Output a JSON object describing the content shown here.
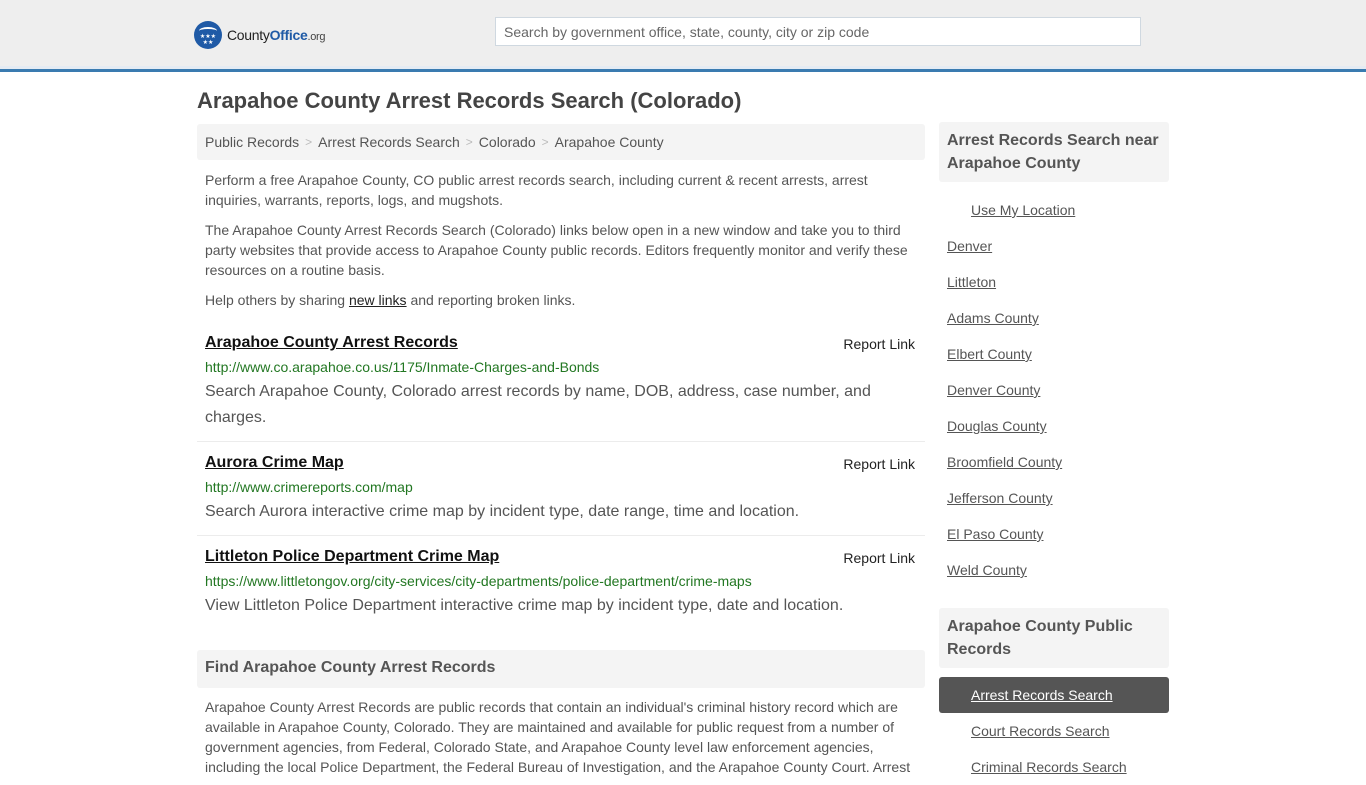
{
  "header": {
    "logo": {
      "county": "County",
      "office": "Office",
      "org": ".org"
    },
    "search": {
      "placeholder": "Search by government office, state, county, city or zip code",
      "value": ""
    }
  },
  "page": {
    "title": "Arapahoe County Arrest Records Search (Colorado)"
  },
  "breadcrumb": {
    "items": [
      "Public Records",
      "Arrest Records Search",
      "Colorado",
      "Arapahoe County"
    ],
    "separator": ">"
  },
  "intro": {
    "p1": "Perform a free Arapahoe County, CO public arrest records search, including current & recent arrests, arrest inquiries, warrants, reports, logs, and mugshots.",
    "p2": "The Arapahoe County Arrest Records Search (Colorado) links below open in a new window and take you to third party websites that provide access to Arapahoe County public records. Editors frequently monitor and verify these resources on a routine basis.",
    "p3_before": "Help others by sharing ",
    "p3_link": "new links",
    "p3_after": " and reporting broken links."
  },
  "results": [
    {
      "title": "Arapahoe County Arrest Records",
      "url": "http://www.co.arapahoe.co.us/1175/Inmate-Charges-and-Bonds",
      "description": "Search Arapahoe County, Colorado arrest records by name, DOB, address, case number, and charges.",
      "report_label": "Report Link"
    },
    {
      "title": "Aurora Crime Map",
      "url": "http://www.crimereports.com/map",
      "description": "Search Aurora interactive crime map by incident type, date range, time and location.",
      "report_label": "Report Link"
    },
    {
      "title": "Littleton Police Department Crime Map",
      "url": "https://www.littletongov.org/city-services/city-departments/police-department/crime-maps",
      "description": "View Littleton Police Department interactive crime map by incident type, date and location.",
      "report_label": "Report Link"
    }
  ],
  "find_section": {
    "heading": "Find Arapahoe County Arrest Records",
    "body": "Arapahoe County Arrest Records are public records that contain an individual's criminal history record which are available in Arapahoe County, Colorado. They are maintained and available for public request from a number of government agencies, from Federal, Colorado State, and Arapahoe County level law enforcement agencies, including the local Police Department, the Federal Bureau of Investigation, and the Arapahoe County Court. Arrest"
  },
  "sidebar": {
    "nearby": {
      "heading": "Arrest Records Search near Arapahoe County",
      "use_location": "Use My Location",
      "items": [
        "Denver",
        "Littleton",
        "Adams County",
        "Elbert County",
        "Denver County",
        "Douglas County",
        "Broomfield County",
        "Jefferson County",
        "El Paso County",
        "Weld County"
      ]
    },
    "public_records": {
      "heading": "Arapahoe County Public Records",
      "items": [
        {
          "label": "Arrest Records Search",
          "active": true
        },
        {
          "label": "Court Records Search",
          "active": false
        },
        {
          "label": "Criminal Records Search",
          "active": false
        }
      ]
    }
  },
  "colors": {
    "accent_blue": "#3a7bb0",
    "url_green": "#227722",
    "active_bg": "#555555"
  }
}
